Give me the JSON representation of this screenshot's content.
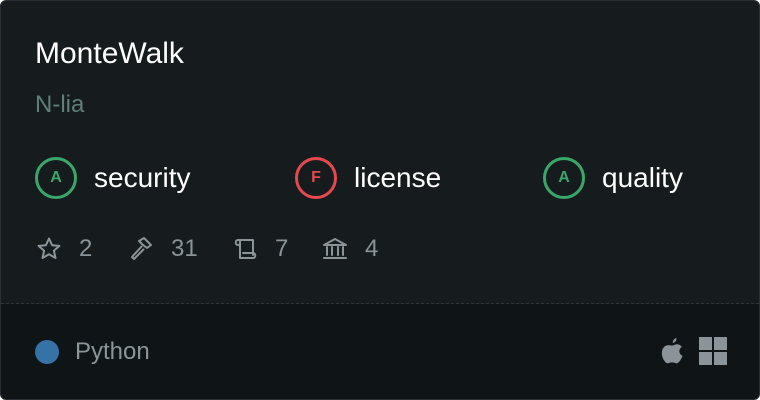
{
  "card": {
    "title": "MonteWalk",
    "org": "N-lia"
  },
  "grades": [
    {
      "grade": "A",
      "label": "security",
      "status": "good",
      "color": "#3aa76a"
    },
    {
      "grade": "F",
      "label": "license",
      "status": "bad",
      "color": "#e5484d"
    },
    {
      "grade": "A",
      "label": "quality",
      "status": "good",
      "color": "#3aa76a"
    }
  ],
  "stats": [
    {
      "icon": "star-icon",
      "value": "2"
    },
    {
      "icon": "hammer-icon",
      "value": "31"
    },
    {
      "icon": "scroll-icon",
      "value": "7"
    },
    {
      "icon": "bank-icon",
      "value": "4"
    }
  ],
  "language": {
    "name": "Python",
    "color": "#3572a5"
  },
  "platforms": [
    {
      "icon": "apple-icon"
    },
    {
      "icon": "windows-icon"
    }
  ],
  "colors": {
    "background": "#161b1e",
    "footer": "#0f1417",
    "text": "#ffffff",
    "muted": "#8a9499",
    "org": "#5f7f78"
  }
}
